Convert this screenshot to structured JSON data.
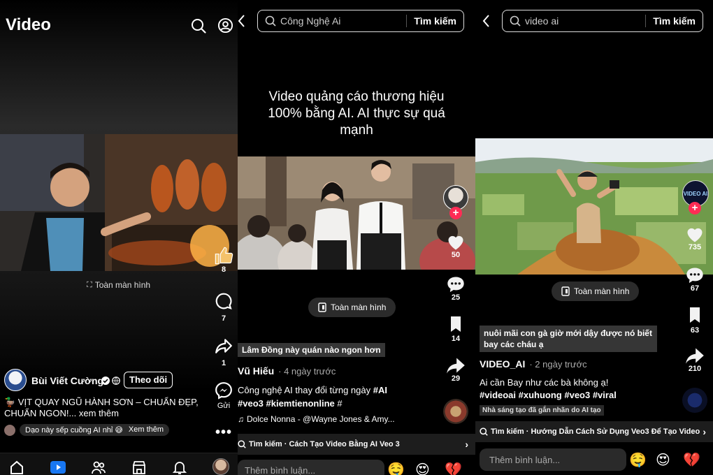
{
  "panel1": {
    "header_title": "Video",
    "fullscreen_label": "Toàn màn hình",
    "like_count": "8",
    "comment_count": "7",
    "share_count": "1",
    "send_label": "Gửi",
    "author": "Bùi Viết Cường",
    "follow_label": "Theo dõi",
    "caption": "🦆 VỊT QUAY NGŨ HÀNH SƠN – CHUẨN ĐẸP, CHUẨN NGON!... xem thêm",
    "comment_preview": "Dạo này sếp cuồng AI nhỉ 😅",
    "see_more": "Xem thêm"
  },
  "panel2": {
    "search_query": "Công Nghệ Ai",
    "search_button": "Tìm kiếm",
    "title_overlay": "Video quảng cáo thương hiệu 100% bằng AI. AI thực sự quá mạnh",
    "like_count": "50",
    "comment_count": "25",
    "save_count": "14",
    "share_count": "29",
    "fullscreen_label": "Toàn màn hình",
    "sticker_text": "Lâm Đồng này quán nào ngon hơn",
    "author": "Vũ Hiếu",
    "time": "· 4 ngày trước",
    "desc_text": "Công nghệ AI thay đổi từng ngày ",
    "tag1": "#AI",
    "tag2": "#veo3",
    "tag3": "#kiemtienonline",
    "tag_tail": " #",
    "music": "Dolce Nonna - @Wayne Jones & Amy...",
    "search_suggestion": "Tìm kiếm · Cách Tạo Video Bằng AI Veo 3",
    "comment_placeholder": "Thêm bình luận...",
    "emojis": [
      "🤤",
      "😍",
      "💔"
    ]
  },
  "panel3": {
    "search_query": "video ai",
    "search_button": "Tìm kiếm",
    "avatar_text": "VIDEO AI",
    "like_count": "735",
    "comment_count": "67",
    "save_count": "63",
    "share_count": "210",
    "fullscreen_label": "Toàn màn hình",
    "sticker_text": "nuôi mãi con gà giờ mới dậy được nó biết bay các cháu ạ",
    "author": "VIDEO_AI",
    "time": "· 2 ngày trước",
    "desc": "Ai cần Bay như các bà không ạ!",
    "tags": "#videoai #xuhuong #veo3 #viral",
    "ai_label": "Nhà sáng tạo đã gắn nhãn do AI tạo",
    "search_suggestion": "Tìm kiếm · Hướng Dẫn Cách Sử Dụng Veo3 Để Tạo Video",
    "comment_placeholder": "Thêm bình luận...",
    "emojis": [
      "🤤",
      "😍",
      "💔"
    ]
  },
  "colors": {
    "accent_red": "#fe2c55",
    "fb_blue": "#1877f2"
  }
}
